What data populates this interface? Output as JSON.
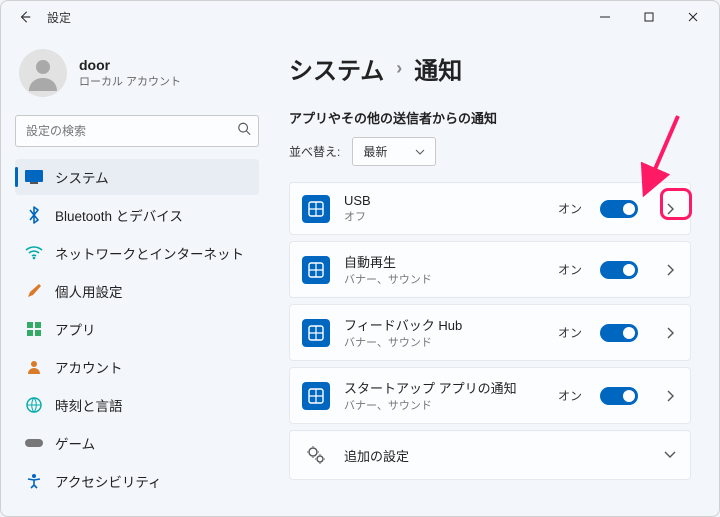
{
  "titlebar": {
    "title": "設定"
  },
  "profile": {
    "name": "door",
    "sub": "ローカル アカウント"
  },
  "search": {
    "placeholder": "設定の検索"
  },
  "nav": {
    "items": [
      {
        "label": "システム"
      },
      {
        "label": "Bluetooth とデバイス"
      },
      {
        "label": "ネットワークとインターネット"
      },
      {
        "label": "個人用設定"
      },
      {
        "label": "アプリ"
      },
      {
        "label": "アカウント"
      },
      {
        "label": "時刻と言語"
      },
      {
        "label": "ゲーム"
      },
      {
        "label": "アクセシビリティ"
      }
    ]
  },
  "main": {
    "crumb1": "システム",
    "crumb2": "通知",
    "section": "アプリやその他の送信者からの通知",
    "sort_label": "並べ替え:",
    "sort_value": "最新",
    "on_label": "オン",
    "apps": [
      {
        "name": "USB",
        "sub": "オフ"
      },
      {
        "name": "自動再生",
        "sub": "バナー、サウンド"
      },
      {
        "name": "フィードバック Hub",
        "sub": "バナー、サウンド"
      },
      {
        "name": "スタートアップ アプリの通知",
        "sub": "バナー、サウンド"
      }
    ],
    "extra": "追加の設定"
  }
}
